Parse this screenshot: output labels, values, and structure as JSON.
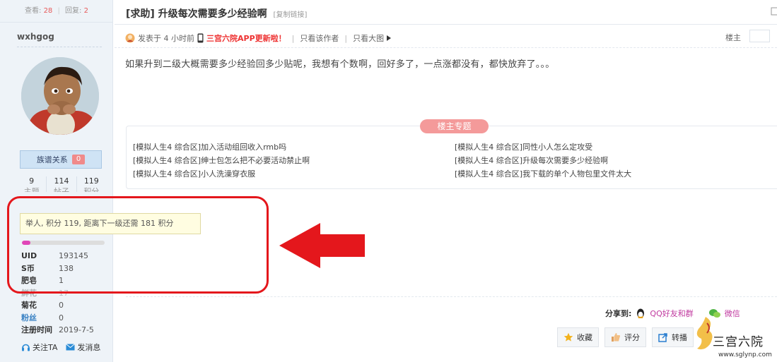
{
  "thread": {
    "views_label": "查看:",
    "views": "28",
    "replies_label": "回复:",
    "replies": "2",
    "title": "[求助] 升级每次需要多少经验啊",
    "copy_link": "[复制链接]"
  },
  "author": {
    "username": "wxhgog",
    "family_label": "族谱关系",
    "family_count": "0",
    "stats": [
      {
        "value": "9",
        "label": "主题"
      },
      {
        "value": "114",
        "label": "帖子"
      },
      {
        "value": "119",
        "label": "积分"
      }
    ],
    "tooltip": "举人, 积分 119, 距离下一级还需 181 积分",
    "progress": 0.1,
    "info": [
      {
        "label": "UID",
        "value": "193145"
      },
      {
        "label": "S币",
        "value": "138"
      },
      {
        "label": "肥皂",
        "value": "1"
      },
      {
        "label": "鲜花",
        "value": "17"
      },
      {
        "label": "菊花",
        "value": "0"
      },
      {
        "label": "粉丝",
        "value": "0"
      },
      {
        "label": "注册时间",
        "value": "2019-7-5"
      }
    ],
    "follow": "关注TA",
    "message": "发消息"
  },
  "post": {
    "posted": "发表于 4 小时前",
    "app_promo": "三宫六院APP更新啦！",
    "only_author": "只看该作者",
    "only_big_image": "只看大图",
    "floor": "楼主",
    "body": "如果升到二级大概需要多少经验回多少贴呢，我想有个数啊，回好多了，一点涨都没有，都快放弃了。。。"
  },
  "feature": {
    "tag": "楼主专题",
    "links": [
      "[模拟人生4 综合区]加入活动组回收入rmb吗",
      "[模拟人生4 综合区]同性小人怎么定攻受",
      "[模拟人生4 综合区]绅士包怎么把不必要活动禁止啊",
      "[模拟人生4 综合区]升级每次需要多少经验啊",
      "[模拟人生4 综合区]小人洗澡穿衣服",
      "[模拟人生4 综合区]我下载的单个人物包里文件太大"
    ]
  },
  "share": {
    "label": "分享到:",
    "qq": "QQ好友和群",
    "wechat": "微信"
  },
  "buttons": {
    "favorite": "收藏",
    "rate": "评分",
    "repost": "转播"
  },
  "watermark": {
    "brand": "三宫六院",
    "url": "www.sglynp.com"
  },
  "colors": {
    "annotation_red": "#e4171c",
    "progress_fill": "#e046b8",
    "feature_tag": "#f49a9a"
  }
}
